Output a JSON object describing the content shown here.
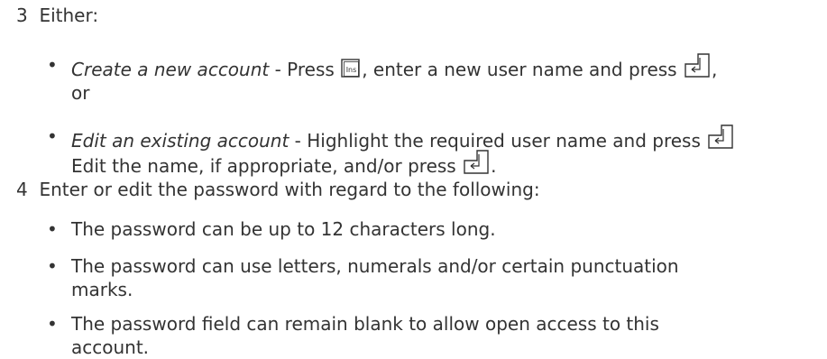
{
  "steps": [
    {
      "number": "3",
      "text": "Either:",
      "bullets": [
        {
          "italic": "Create a new account",
          "part1": " - Press ",
          "key1": "Ins",
          "part2": ", enter a new user name and press ",
          "part3": ",",
          "line2": "or"
        },
        {
          "italic": "Edit an existing account",
          "part1": " - Highlight the required user name and press ",
          "line2": "Edit the name, if appropriate, and/or press ",
          "line2_end": "."
        }
      ]
    },
    {
      "number": "4",
      "text": "Enter or edit the password with regard to the following:",
      "bullets": [
        {
          "line1": "The password can be up to 12 characters long."
        },
        {
          "line1": "The password can use letters, numerals and/or certain punctuation",
          "line2": "marks."
        },
        {
          "line1": "The password field can remain blank to allow open access to this",
          "line2": "account."
        }
      ]
    }
  ],
  "bullet_char": "•",
  "colors": {
    "text": "#333333"
  }
}
